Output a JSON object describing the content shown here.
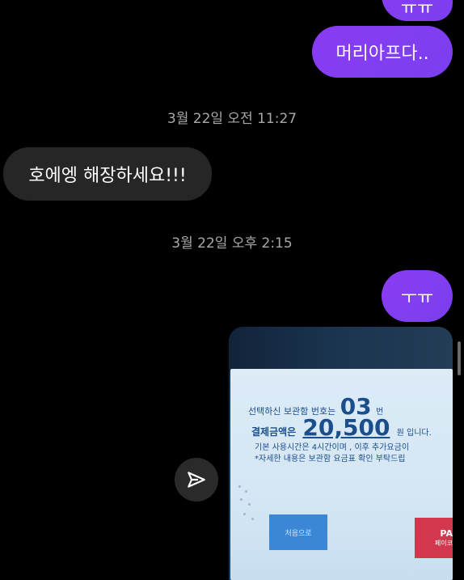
{
  "messages": {
    "sent_top_partial": "ㅠㅠ",
    "sent_1": "머리아프다..",
    "timestamp_1": "3월 22일 오전 11:27",
    "received_1": "호에엥 해장하세요!!!",
    "timestamp_2": "3월 22일 오후 2:15",
    "sent_2": "ㅜㅠ"
  },
  "photo": {
    "line1_prefix": "선택하신 보관함 번호는",
    "line1_number": "03",
    "line1_suffix": "번",
    "line2_prefix": "결제금액은",
    "line2_amount": "20,500",
    "line2_suffix": "원 입니다.",
    "line3": "기본 사용시간은 4시간이며 , 이후 추가요금이",
    "line4": "*자세한 내용은 보관함 요금표 확인 부탁드립",
    "button_label": "처음으로",
    "badge_top": "PA",
    "badge_bottom": "페이코"
  },
  "icons": {
    "share": "paper-plane-icon"
  },
  "colors": {
    "sent_bubble": "#8a3cf2",
    "received_bubble": "#262626",
    "timestamp": "#a8a8a8",
    "background": "#000000"
  }
}
